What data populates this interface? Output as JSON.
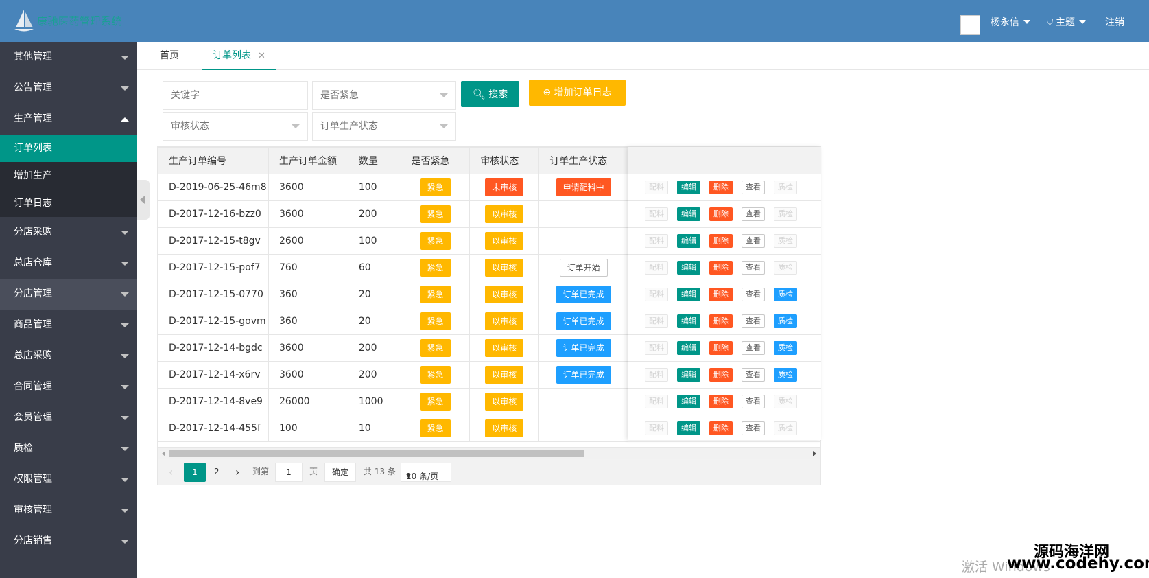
{
  "header": {
    "brand": "康驰医药管理系统",
    "user": "杨永信",
    "theme": "主题",
    "logout": "注销"
  },
  "sidebar": {
    "items": [
      {
        "label": "其他管理"
      },
      {
        "label": "公告管理"
      },
      {
        "label": "生产管理"
      },
      {
        "label": "分店采购"
      },
      {
        "label": "总店仓库"
      },
      {
        "label": "分店管理"
      },
      {
        "label": "商品管理"
      },
      {
        "label": "总店采购"
      },
      {
        "label": "合同管理"
      },
      {
        "label": "会员管理"
      },
      {
        "label": "质检"
      },
      {
        "label": "权限管理"
      },
      {
        "label": "审核管理"
      },
      {
        "label": "分店销售"
      }
    ],
    "sub": [
      "订单列表",
      "增加生产",
      "订单日志"
    ]
  },
  "tabs": {
    "home": "首页",
    "current": "订单列表",
    "close": "✕"
  },
  "filters": {
    "keyword": "关键字",
    "urgent": "是否紧急",
    "search": "搜索",
    "add_log": "增加订单日志",
    "audit": "审核状态",
    "prod_status": "订单生产状态"
  },
  "table": {
    "headers": [
      "生产订单编号",
      "生产订单金额",
      "数量",
      "是否紧急",
      "审核状态",
      "订单生产状态"
    ],
    "rows": [
      {
        "id": "D-2019-06-25-46m8",
        "amount": "3600",
        "qty": "100",
        "urgent": "紧急",
        "audit": "未审核",
        "status": "申请配料中"
      },
      {
        "id": "D-2017-12-16-bzz0",
        "amount": "3600",
        "qty": "200",
        "urgent": "紧急",
        "audit": "以审核",
        "status": ""
      },
      {
        "id": "D-2017-12-15-t8gv",
        "amount": "2600",
        "qty": "100",
        "urgent": "紧急",
        "audit": "以审核",
        "status": ""
      },
      {
        "id": "D-2017-12-15-pof7",
        "amount": "760",
        "qty": "60",
        "urgent": "紧急",
        "audit": "以审核",
        "status": "订单开始"
      },
      {
        "id": "D-2017-12-15-0770",
        "amount": "360",
        "qty": "20",
        "urgent": "紧急",
        "audit": "以审核",
        "status": "订单已完成"
      },
      {
        "id": "D-2017-12-15-govm",
        "amount": "360",
        "qty": "20",
        "urgent": "紧急",
        "audit": "以审核",
        "status": "订单已完成"
      },
      {
        "id": "D-2017-12-14-bgdc",
        "amount": "3600",
        "qty": "200",
        "urgent": "紧急",
        "audit": "以审核",
        "status": "订单已完成"
      },
      {
        "id": "D-2017-12-14-x6rv",
        "amount": "3600",
        "qty": "200",
        "urgent": "紧急",
        "audit": "以审核",
        "status": "订单已完成"
      },
      {
        "id": "D-2017-12-14-8ve9",
        "amount": "26000",
        "qty": "1000",
        "urgent": "紧急",
        "audit": "以审核",
        "status": ""
      },
      {
        "id": "D-2017-12-14-455f",
        "amount": "100",
        "qty": "10",
        "urgent": "紧急",
        "audit": "以审核",
        "status": ""
      }
    ],
    "actions": [
      "配料",
      "编辑",
      "删除",
      "查看",
      "质检"
    ]
  },
  "pager": {
    "page1": "1",
    "page2": "2",
    "goto": "到第",
    "goto_value": "1",
    "page_unit": "页",
    "confirm": "确定",
    "total": "共 13 条",
    "per_page": "10 条/页"
  },
  "watermark": "激活 Windows",
  "site": {
    "cn": "源码海洋网",
    "en": "www.codehy.com"
  }
}
